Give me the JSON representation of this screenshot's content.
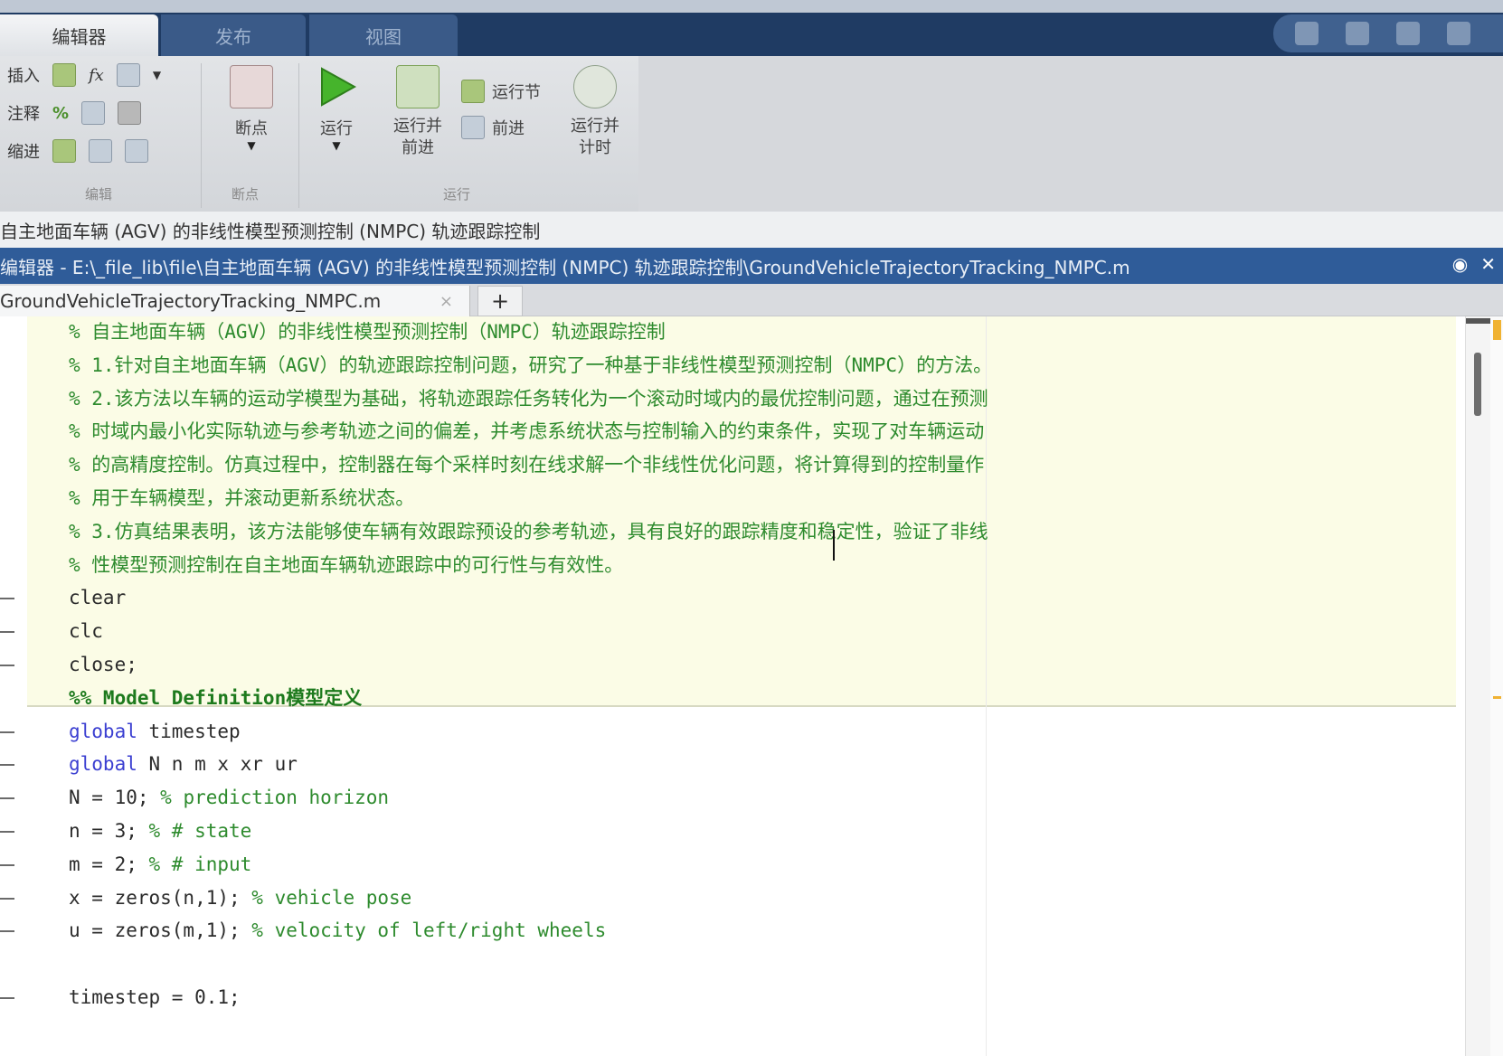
{
  "ribbon_tabs": [
    "编辑器",
    "发布",
    "视图"
  ],
  "ribbon": {
    "edit_group": {
      "insert_label": "插入",
      "comment_label": "注释",
      "indent_label": "缩进",
      "fx_label": "fx",
      "group_label": "编辑"
    },
    "breakpoint_group": {
      "button_label": "断点",
      "group_label": "断点"
    },
    "run_group": {
      "run_label": "运行",
      "run_advance_label": "运行并\n前进",
      "run_section_label": "运行节",
      "advance_label": "前进",
      "run_time_label": "运行并\n计时",
      "group_label": "运行"
    }
  },
  "title_bar": "自主地面车辆 (AGV) 的非线性模型预测控制 (NMPC) 轨迹跟踪控制",
  "path_bar": "编辑器 - E:\\_file_lib\\file\\自主地面车辆 (AGV) 的非线性模型预测控制 (NMPC) 轨迹跟踪控制\\GroundVehicleTrajectoryTracking_NMPC.m",
  "file_tab": {
    "name": "GroundVehicleTrajectoryTracking_NMPC.m",
    "close": "×",
    "add": "+"
  },
  "code_lines": [
    {
      "kind": "comment",
      "text": "% 自主地面车辆（AGV）的非线性模型预测控制（NMPC）轨迹跟踪控制"
    },
    {
      "kind": "comment",
      "text": "% 1.针对自主地面车辆（AGV）的轨迹跟踪控制问题，研究了一种基于非线性模型预测控制（NMPC）的方法。"
    },
    {
      "kind": "comment",
      "text": "% 2.该方法以车辆的运动学模型为基础，将轨迹跟踪任务转化为一个滚动时域内的最优控制问题，通过在预测"
    },
    {
      "kind": "comment",
      "text": "% 时域内最小化实际轨迹与参考轨迹之间的偏差，并考虑系统状态与控制输入的约束条件，实现了对车辆运动"
    },
    {
      "kind": "comment",
      "text": "% 的高精度控制。仿真过程中，控制器在每个采样时刻在线求解一个非线性优化问题，将计算得到的控制量作"
    },
    {
      "kind": "comment",
      "text": "% 用于车辆模型，并滚动更新系统状态。"
    },
    {
      "kind": "comment",
      "text": "% 3.仿真结果表明，该方法能够使车辆有效跟踪预设的参考轨迹，具有良好的跟踪精度和稳定性，验证了非线"
    },
    {
      "kind": "comment",
      "text": "% 性模型预测控制在自主地面车辆轨迹跟踪中的可行性与有效性。"
    },
    {
      "kind": "code",
      "text": "clear"
    },
    {
      "kind": "code",
      "text": "clc"
    },
    {
      "kind": "code",
      "text": "close;"
    },
    {
      "kind": "section",
      "text": "%% Model Definition模型定义"
    },
    {
      "kind": "kwline",
      "kw": "global",
      "rest": " timestep"
    },
    {
      "kind": "kwline",
      "kw": "global",
      "rest": " N n m x xr ur"
    },
    {
      "kind": "assign",
      "code": "N = 10;",
      "cm": " % prediction horizon"
    },
    {
      "kind": "assign",
      "code": "n = 3;",
      "cm": " % # state"
    },
    {
      "kind": "assign",
      "code": "m = 2;",
      "cm": " % # input"
    },
    {
      "kind": "assign",
      "code": "x = zeros(n,1);",
      "cm": " % vehicle pose"
    },
    {
      "kind": "assign",
      "code": "u = zeros(m,1);",
      "cm": " % velocity of left/right wheels"
    },
    {
      "kind": "blank",
      "text": ""
    },
    {
      "kind": "assign",
      "code": "timestep = 0.1;",
      "cm": ""
    }
  ],
  "colors": {
    "title_bar_bg": "#2f5c99",
    "cell_highlight": "#fbfce6",
    "comment": "#2e8b2e",
    "keyword": "#3b3fd1"
  }
}
